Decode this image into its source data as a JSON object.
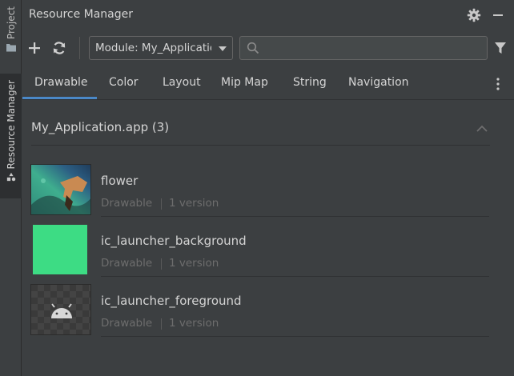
{
  "sidebar": {
    "project_label": "Project",
    "resource_manager_label": "Resource Manager"
  },
  "panel": {
    "title": "Resource Manager",
    "toolbar": {
      "add_icon": "plus-icon",
      "refresh_icon": "refresh-icon",
      "module_label": "Module: My_Application",
      "search_value": "",
      "filter_icon": "filter-icon"
    },
    "tabs": [
      {
        "label": "Drawable",
        "selected": true
      },
      {
        "label": "Color"
      },
      {
        "label": "Layout"
      },
      {
        "label": "Mip Map"
      },
      {
        "label": "String"
      },
      {
        "label": "Navigation"
      }
    ],
    "group": {
      "title": "My_Application.app (3)"
    },
    "items": [
      {
        "name": "flower",
        "type": "Drawable",
        "versions": "1 version"
      },
      {
        "name": "ic_launcher_background",
        "type": "Drawable",
        "versions": "1 version",
        "color": "#3ddc84"
      },
      {
        "name": "ic_launcher_foreground",
        "type": "Drawable",
        "versions": "1 version"
      }
    ]
  },
  "colors": {
    "background": "#3c3f41",
    "accent": "#4a88c7",
    "launcher_green": "#3ddc84"
  }
}
